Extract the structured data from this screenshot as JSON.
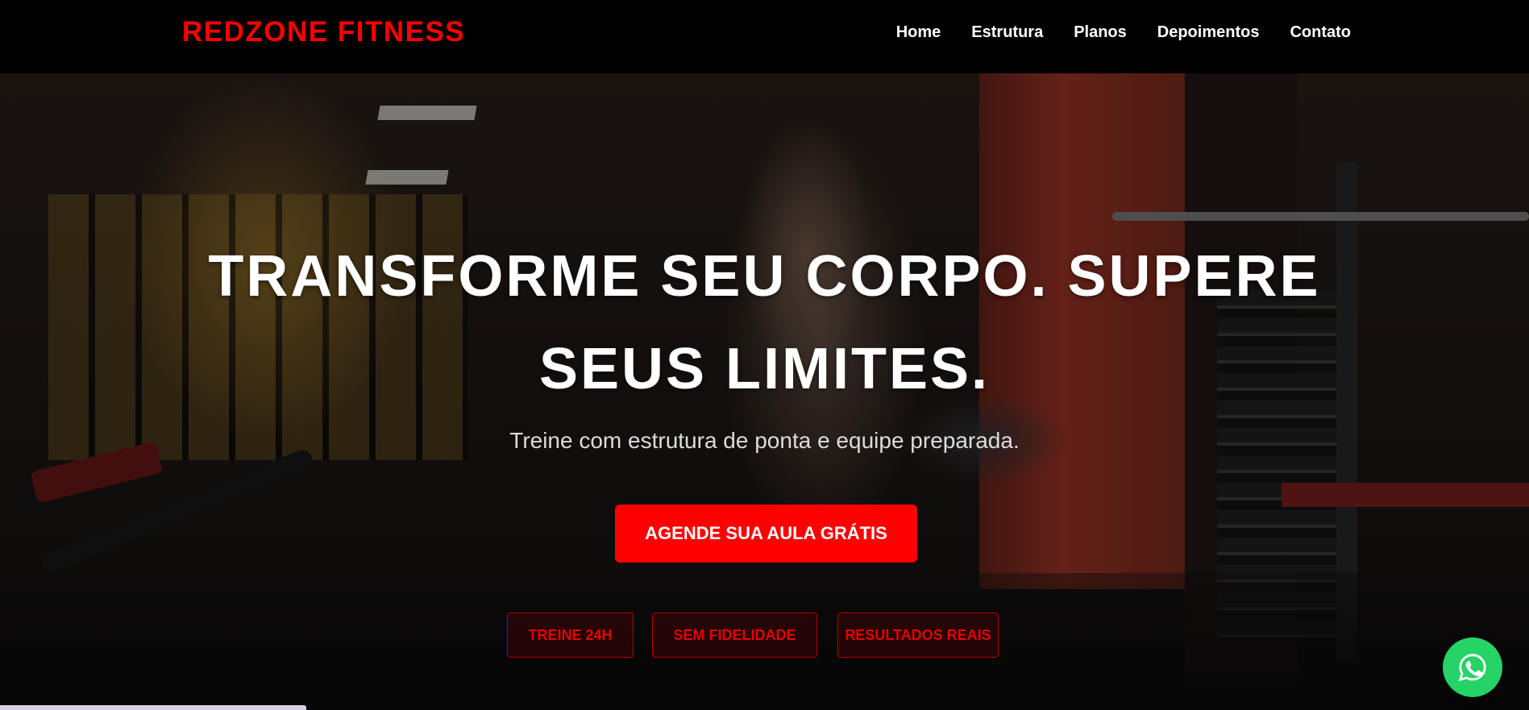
{
  "brand": {
    "name": "REDZONE FITNESS",
    "color": "#ff0000"
  },
  "nav": {
    "items": [
      {
        "label": "Home"
      },
      {
        "label": "Estrutura"
      },
      {
        "label": "Planos"
      },
      {
        "label": "Depoimentos"
      },
      {
        "label": "Contato"
      }
    ]
  },
  "hero": {
    "title": "TRANSFORME SEU CORPO. SUPERE SEUS LIMITES.",
    "subtitle": "Treine com estrutura de ponta e equipe preparada.",
    "cta_label": "AGENDE SUA AULA GRÁTIS",
    "badges": [
      {
        "label": "TREINE 24H"
      },
      {
        "label": "SEM FIDELIDADE"
      },
      {
        "label": "RESULTADOS REAIS"
      }
    ],
    "background_image": "gym-athlete-squat-photo"
  },
  "floating": {
    "whatsapp_icon": "whatsapp-icon",
    "whatsapp_color": "#25d366"
  },
  "colors": {
    "accent": "#ff0000",
    "navbar_bg": "#000000",
    "text_on_dark": "#ffffff"
  }
}
